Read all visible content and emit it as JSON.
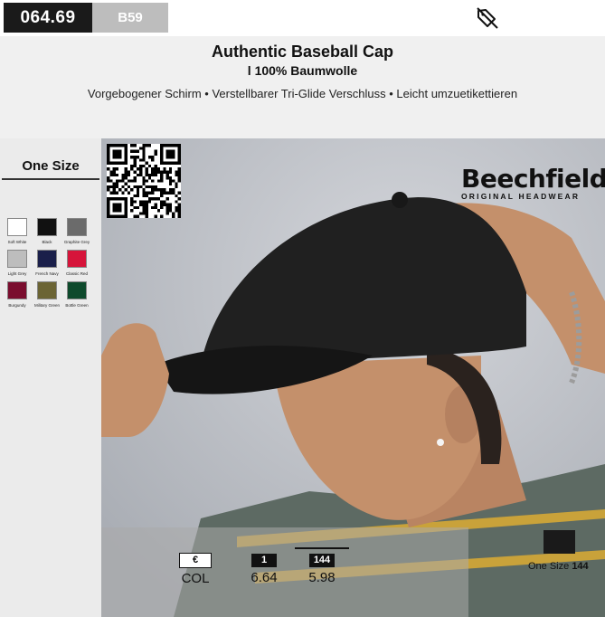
{
  "header_bar": {
    "code": "064.69",
    "sub_code": "B59"
  },
  "product": {
    "title": "Authentic Baseball Cap",
    "subtitle": "l 100% Baumwolle",
    "features": "Vorgebogener Schirm • Verstellbarer Tri-Glide Verschluss • Leicht umzuetikettieren"
  },
  "size": "One Size",
  "colors": [
    {
      "name": "Soft White",
      "hex": "#ffffff"
    },
    {
      "name": "Black",
      "hex": "#111111"
    },
    {
      "name": "Graphite Grey",
      "hex": "#6b6b6b"
    },
    {
      "name": "Light Grey",
      "hex": "#bdbdbd"
    },
    {
      "name": "French Navy",
      "hex": "#1a1f4a"
    },
    {
      "name": "Classic Red",
      "hex": "#d6143a"
    },
    {
      "name": "Burgundy",
      "hex": "#7a0d2e"
    },
    {
      "name": "Military Green",
      "hex": "#6b6434"
    },
    {
      "name": "Bottle Green",
      "hex": "#0e4a2c"
    }
  ],
  "brand": {
    "name": "Beechfield",
    "tagline": "ORIGINAL HEADWEAR"
  },
  "pricing": {
    "currency_symbol": "€",
    "col_label": "COL",
    "tiers": [
      {
        "qty": "1",
        "price": "6.64"
      },
      {
        "qty": "144",
        "price": "5.98"
      }
    ]
  },
  "carton": {
    "size_label": "One Size",
    "quantity": "144"
  },
  "icons": {
    "tag": "tag-icon",
    "qr": "qr-code-icon"
  }
}
